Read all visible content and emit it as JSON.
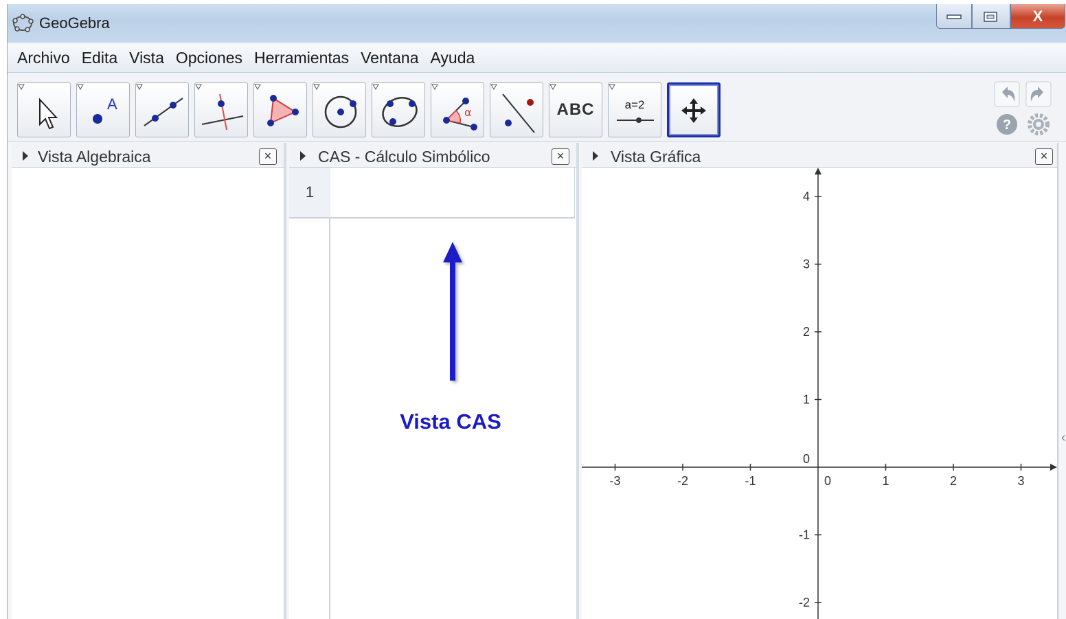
{
  "window": {
    "title": "GeoGebra",
    "controls": {
      "close": "X"
    }
  },
  "menu": [
    "Archivo",
    "Edita",
    "Vista",
    "Opciones",
    "Herramientas",
    "Ventana",
    "Ayuda"
  ],
  "toolbar": {
    "tools": [
      {
        "icon": "move-pointer-icon"
      },
      {
        "icon": "point-icon",
        "text": "A"
      },
      {
        "icon": "line-icon"
      },
      {
        "icon": "perpendicular-line-icon"
      },
      {
        "icon": "polygon-icon"
      },
      {
        "icon": "circle-icon"
      },
      {
        "icon": "conic-icon"
      },
      {
        "icon": "angle-icon",
        "text": "α"
      },
      {
        "icon": "reflect-icon"
      },
      {
        "icon": "text-tool-icon",
        "text": "ABC"
      },
      {
        "icon": "slider-icon",
        "text": "a=2"
      },
      {
        "icon": "move-graphics-view-icon",
        "active": true
      }
    ],
    "right_icons": [
      "undo-icon",
      "redo-icon",
      "help-icon",
      "settings-icon"
    ]
  },
  "panels": {
    "algebra": {
      "title": "Vista Algebraica",
      "close": "×"
    },
    "cas": {
      "title": "CAS - Cálculo Simbólico",
      "close": "×",
      "rows": [
        {
          "number": "1",
          "input": ""
        }
      ]
    },
    "graphics": {
      "title": "Vista Gráfica",
      "close": "×"
    }
  },
  "annotation": {
    "label": "Vista CAS",
    "color": "#1a1ac8"
  },
  "graph": {
    "x_ticks": [
      "-3",
      "-2",
      "-1",
      "0",
      "1",
      "2",
      "3"
    ],
    "y_ticks": [
      "-2",
      "-1",
      "0",
      "1",
      "2",
      "3",
      "4"
    ],
    "x_values": [
      -3,
      -2,
      -1,
      0,
      1,
      2,
      3
    ],
    "y_values": [
      -2,
      -1,
      0,
      1,
      2,
      3,
      4
    ]
  }
}
